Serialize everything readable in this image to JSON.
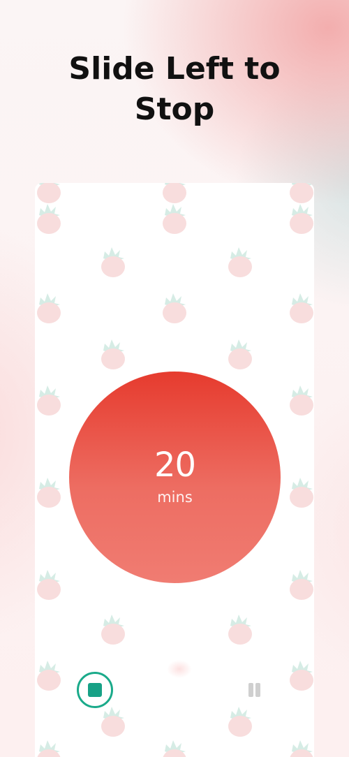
{
  "headline": {
    "line1": "Slide Left to",
    "line2": "Stop"
  },
  "timer": {
    "value": "20",
    "unit": "mins"
  },
  "controls": {
    "stop_icon": "stop-icon",
    "pause_icon": "pause-icon"
  },
  "colors": {
    "timer_top": "#e63b2e",
    "timer_bottom": "#f07c72",
    "stop_accent": "#17a186",
    "pattern_fruit": "#f7dada",
    "pattern_leaf": "#d8ece6"
  }
}
